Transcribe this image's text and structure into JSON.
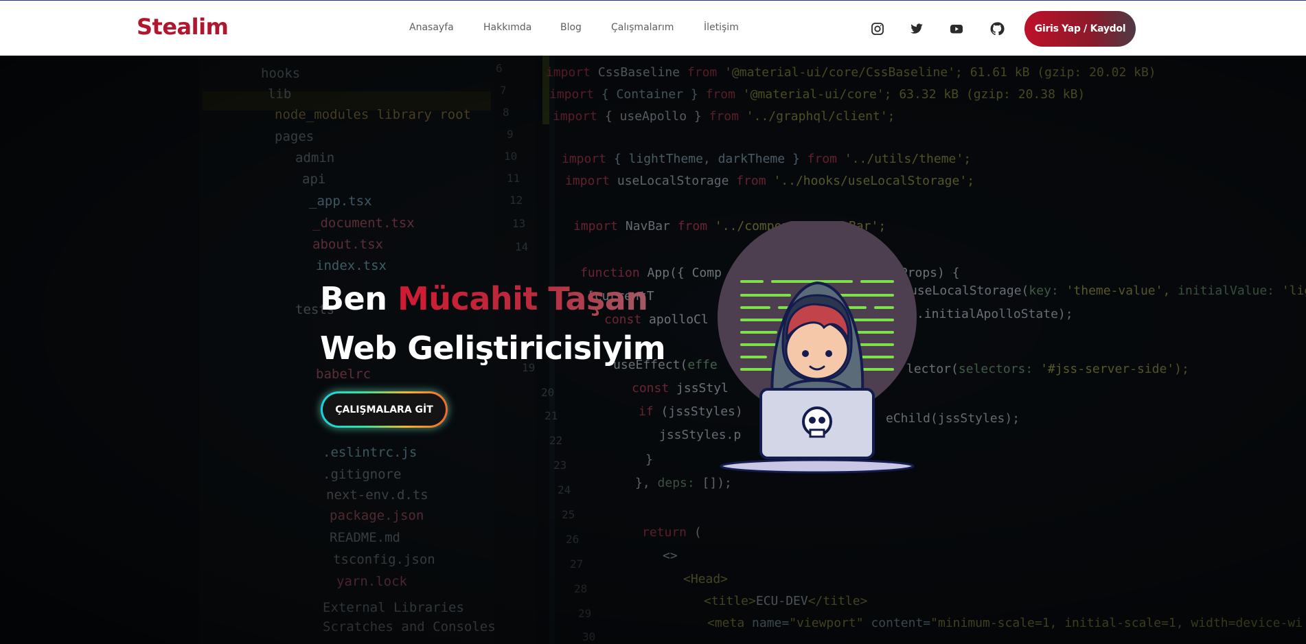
{
  "brand": {
    "logo": "Stealim"
  },
  "nav": {
    "items": [
      {
        "label": "Anasayfa"
      },
      {
        "label": "Hakkımda"
      },
      {
        "label": "Blog"
      },
      {
        "label": "Çalışmalarım"
      },
      {
        "label": "İletişim"
      }
    ],
    "social_icons": [
      "instagram-icon",
      "twitter-icon",
      "youtube-icon",
      "github-icon"
    ],
    "login_label": "Giris Yap / Kaydol"
  },
  "hero": {
    "greeting": "Ben",
    "name": "Mücahit Taşan",
    "subtitle": "Web Geliştiricisiyim",
    "cta_label": "ÇALIŞMALARA GİT"
  },
  "colors": {
    "brand_red": "#b0172e",
    "nav_text": "#5f5f5f",
    "hero_bg": "#05080b"
  }
}
